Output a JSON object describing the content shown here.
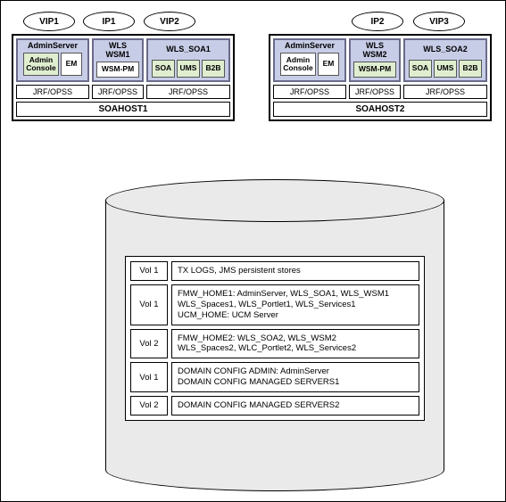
{
  "ellipses": {
    "host1": [
      "VIP1",
      "IP1",
      "VIP2"
    ],
    "host2": [
      "IP2",
      "VIP3"
    ]
  },
  "host1": {
    "name": "SOAHOST1",
    "servers": [
      {
        "title": "AdminServer",
        "comps": [
          {
            "label": "Admin\nConsole",
            "green": true
          },
          {
            "label": "EM",
            "green": false
          }
        ]
      },
      {
        "title": "WLS\nWSM1",
        "comps": [
          {
            "label": "WSM-PM",
            "green": false
          }
        ]
      },
      {
        "title": "WLS_SOA1",
        "comps": [
          {
            "label": "SOA",
            "green": true
          },
          {
            "label": "UMS",
            "green": true
          },
          {
            "label": "B2B",
            "green": true
          }
        ]
      }
    ],
    "jrf": [
      "JRF/OPSS",
      "JRF/OPSS",
      "JRF/OPSS"
    ]
  },
  "host2": {
    "name": "SOAHOST2",
    "servers": [
      {
        "title": "AdminServer",
        "comps": [
          {
            "label": "Admin\nConsole",
            "green": false
          },
          {
            "label": "EM",
            "green": false
          }
        ]
      },
      {
        "title": "WLS\nWSM2",
        "comps": [
          {
            "label": "WSM-PM",
            "green": true
          }
        ]
      },
      {
        "title": "WLS_SOA2",
        "comps": [
          {
            "label": "SOA",
            "green": true
          },
          {
            "label": "UMS",
            "green": true
          },
          {
            "label": "B2B",
            "green": true
          }
        ]
      }
    ],
    "jrf": [
      "JRF/OPSS",
      "JRF/OPSS",
      "JRF/OPSS"
    ]
  },
  "volumes": [
    {
      "vol": "Vol 1",
      "desc": "TX LOGS, JMS persistent stores"
    },
    {
      "vol": "Vol 1",
      "desc": "FMW_HOME1: AdminServer, WLS_SOA1, WLS_WSM1\nWLS_Spaces1, WLS_Portlet1, WLS_Services1\nUCM_HOME: UCM Server"
    },
    {
      "vol": "Vol 2",
      "desc": "FMW_HOME2: WLS_SOA2, WLS_WSM2\nWLS_Spaces2, WLC_Portlet2, WLS_Services2"
    },
    {
      "vol": "Vol 1",
      "desc": "DOMAIN CONFIG ADMIN: AdminServer\nDOMAIN CONFIG MANAGED SERVERS1"
    },
    {
      "vol": "Vol 2",
      "desc": "DOMAIN CONFIG MANAGED SERVERS2"
    }
  ]
}
